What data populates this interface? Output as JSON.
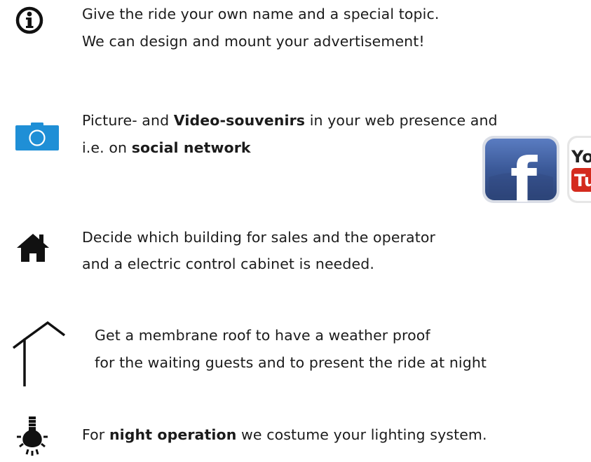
{
  "items": [
    {
      "icon": "info-icon",
      "lines": [
        [
          "Give the ride your own name and a special topic."
        ],
        [
          "We can design and mount your advertisement!"
        ]
      ]
    },
    {
      "icon": "camera-icon",
      "lines": [
        [
          "Picture- and ",
          "Video-souvenirs",
          " in your web presence and"
        ],
        [
          "i.e. on ",
          "social network"
        ]
      ],
      "logos": [
        "facebook-logo",
        "youtube-logo"
      ],
      "logo_text": [
        "f",
        "You",
        "Tube"
      ]
    },
    {
      "icon": "house-icon",
      "lines": [
        [
          "Decide which building for sales and the operator"
        ],
        [
          "and a electric control cabinet is needed."
        ]
      ]
    },
    {
      "icon": "roof-outline-icon",
      "lines": [
        [
          "Get a membrane roof to have a weather proof"
        ],
        [
          "for the waiting guests and to present the ride at night"
        ]
      ]
    },
    {
      "icon": "lightbulb-icon",
      "lines": [
        [
          "For ",
          "night operation",
          " we costume your lighting system."
        ]
      ]
    }
  ],
  "colors": {
    "text": "#1b1b1b",
    "camera_blue": "#1f8fd6",
    "facebook_blue": "#3b5998",
    "youtube_red": "#d42b1e"
  }
}
